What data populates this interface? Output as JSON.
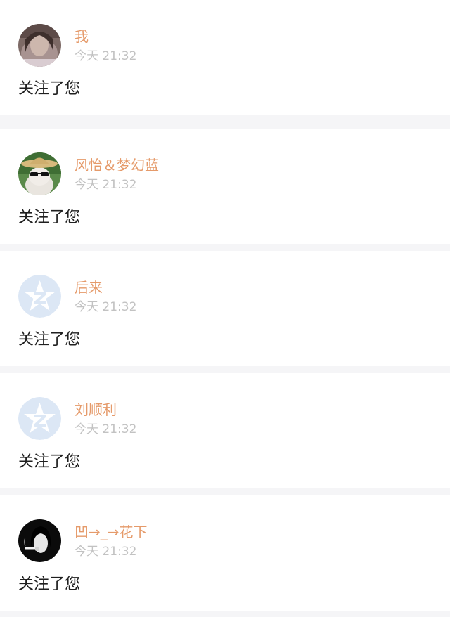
{
  "notifications": [
    {
      "user": "我",
      "time": "今天 21:32",
      "message": "关注了您",
      "avatar_icon": "photo-avatar-girl-icon"
    },
    {
      "user": "风怡＆梦幻蓝",
      "time": "今天 21:32",
      "message": "关注了您",
      "avatar_icon": "cat-sunglasses-hat-avatar-icon"
    },
    {
      "user": "后来",
      "time": "今天 21:32",
      "message": "关注了您",
      "avatar_icon": "default-qzone-star-avatar-icon"
    },
    {
      "user": "刘顺利",
      "time": "今天 21:32",
      "message": "关注了您",
      "avatar_icon": "default-qzone-star-avatar-icon"
    },
    {
      "user": "凹→_→花下",
      "time": "今天 21:32",
      "message": "关注了您",
      "avatar_icon": "smoking-girl-avatar-icon"
    }
  ],
  "colors": {
    "name": "#e59a6a",
    "time": "#c2c2c2",
    "message": "#1f1f1f",
    "divider": "#f5f5f7",
    "default_avatar": "#dce7f5"
  }
}
